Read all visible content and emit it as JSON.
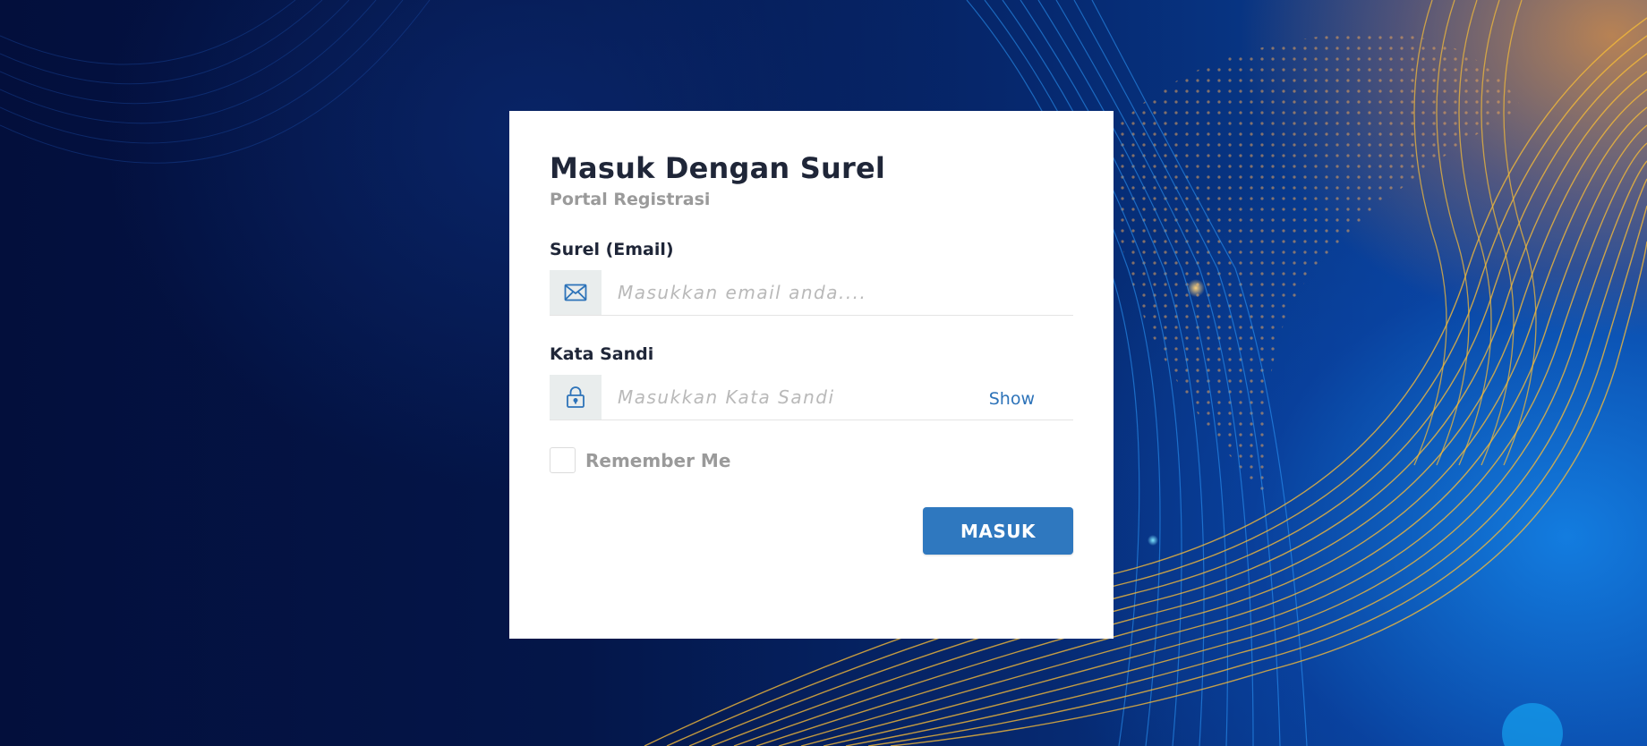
{
  "login": {
    "title": "Masuk Dengan Surel",
    "subtitle": "Portal Registrasi",
    "email": {
      "label": "Surel (Email)",
      "value": "",
      "placeholder": "Masukkan email anda....",
      "icon": "envelope-icon"
    },
    "password": {
      "label": "Kata Sandi",
      "value": "",
      "placeholder": "Masukkan Kata Sandi",
      "icon": "lock-icon",
      "toggle_label": "Show"
    },
    "remember": {
      "label": "Remember Me",
      "checked": false
    },
    "submit_label": "MASUK"
  },
  "colors": {
    "accent": "#2f78bf",
    "link": "#2d73b9",
    "addon_bg": "#e9eded",
    "title": "#1f2638",
    "muted": "#9a9a9a"
  }
}
